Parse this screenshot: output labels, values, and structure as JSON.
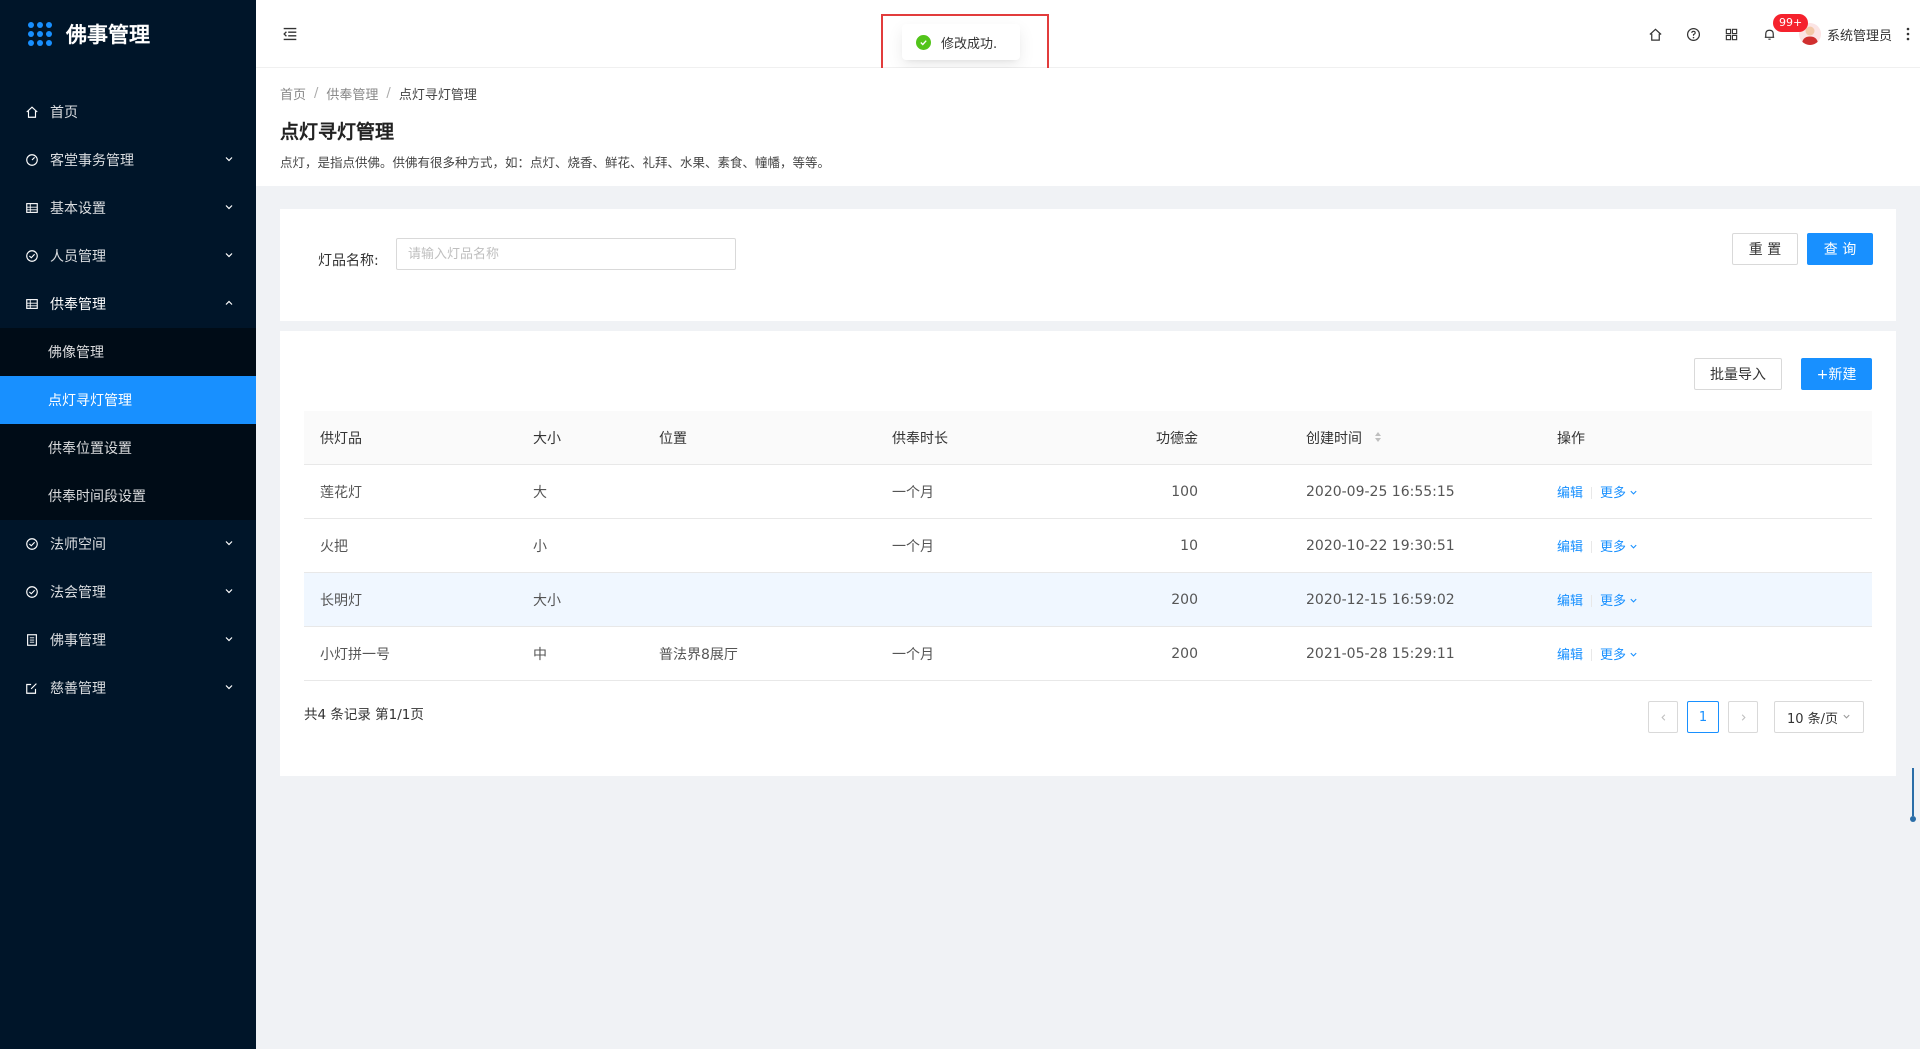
{
  "app": {
    "title": "佛事管理"
  },
  "sidebar": {
    "items": [
      {
        "label": "首页",
        "icon": "home-icon",
        "expandable": false
      },
      {
        "label": "客堂事务管理",
        "icon": "dashboard-icon",
        "expandable": true
      },
      {
        "label": "基本设置",
        "icon": "table-icon",
        "expandable": true
      },
      {
        "label": "人员管理",
        "icon": "check-circle-icon",
        "expandable": true
      },
      {
        "label": "供奉管理",
        "icon": "table-icon",
        "expandable": true,
        "open": true,
        "children": [
          {
            "label": "佛像管理"
          },
          {
            "label": "点灯寻灯管理",
            "active": true
          },
          {
            "label": "供奉位置设置"
          },
          {
            "label": "供奉时间段设置"
          }
        ]
      },
      {
        "label": "法师空间",
        "icon": "check-circle-icon",
        "expandable": true
      },
      {
        "label": "法会管理",
        "icon": "check-circle-icon",
        "expandable": true
      },
      {
        "label": "佛事管理",
        "icon": "profile-icon",
        "expandable": true
      },
      {
        "label": "慈善管理",
        "icon": "form-icon",
        "expandable": true
      }
    ]
  },
  "header": {
    "notification_count": "99+",
    "user_name": "系统管理员"
  },
  "toast": {
    "message": "修改成功."
  },
  "breadcrumb": [
    "首页",
    "供奉管理",
    "点灯寻灯管理"
  ],
  "page": {
    "title": "点灯寻灯管理",
    "description": "点灯，是指点供佛。供佛有很多种方式，如：点灯、烧香、鲜花、礼拜、水果、素食、幢幡，等等。"
  },
  "search": {
    "label": "灯品名称:",
    "placeholder": "请输入灯品名称",
    "reset_label": "重 置",
    "query_label": "查 询"
  },
  "toolbar": {
    "import_label": "批量导入",
    "new_label": "+新建"
  },
  "table": {
    "columns": [
      "供灯品",
      "大小",
      "位置",
      "供奉时长",
      "功德金",
      "创建时间",
      "操作"
    ],
    "rows": [
      {
        "name": "莲花灯",
        "size": "大",
        "position": "",
        "duration": "一个月",
        "merit": "100",
        "created": "2020-09-25 16:55:15"
      },
      {
        "name": "火把",
        "size": "小",
        "position": "",
        "duration": "一个月",
        "merit": "10",
        "created": "2020-10-22 19:30:51"
      },
      {
        "name": "长明灯",
        "size": "大小",
        "position": "",
        "duration": "",
        "merit": "200",
        "created": "2020-12-15 16:59:02"
      },
      {
        "name": "小灯拼一号",
        "size": "中",
        "position": "普法界8展厅",
        "duration": "一个月",
        "merit": "200",
        "created": "2021-05-28 15:29:11"
      }
    ],
    "edit_label": "编辑",
    "more_label": "更多"
  },
  "pagination": {
    "total_text": "共4 条记录 第1/1页",
    "current_page": "1",
    "page_size": "10 条/页"
  },
  "colors": {
    "primary": "#1890ff",
    "sidebar_bg": "#001529",
    "submenu_bg": "#000c17",
    "success": "#52c41a",
    "badge": "#f5222d"
  }
}
